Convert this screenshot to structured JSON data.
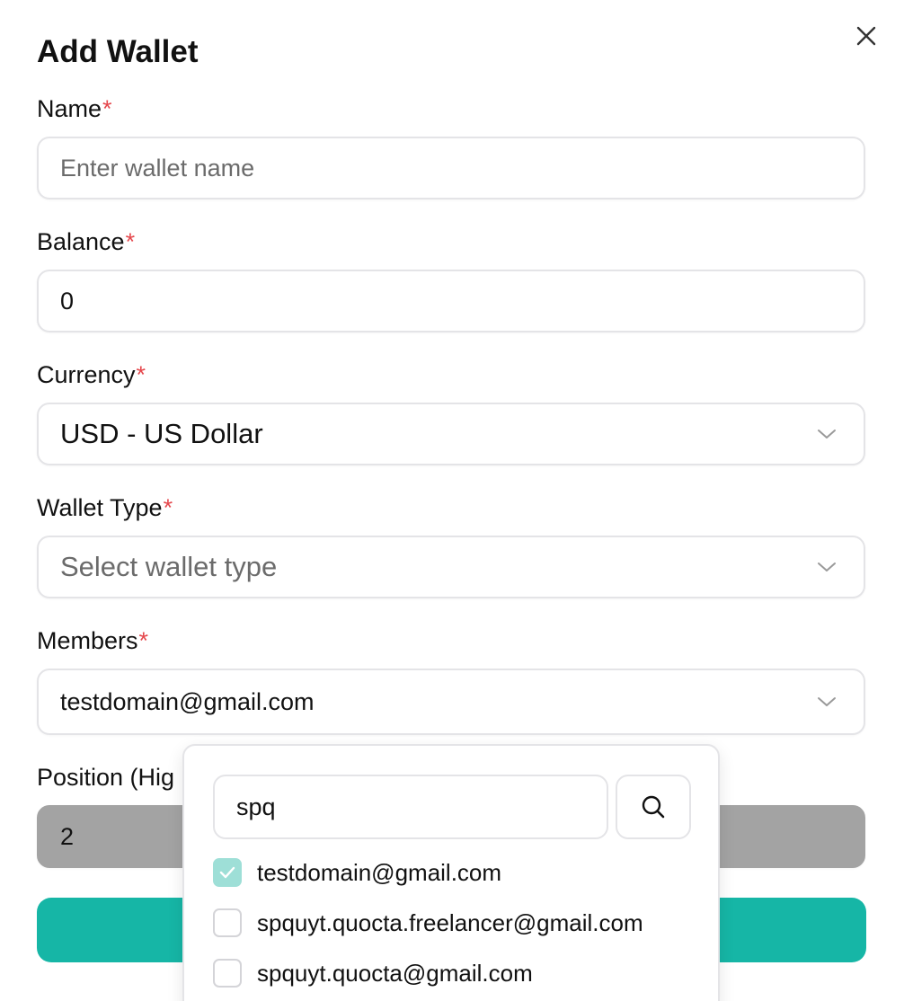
{
  "dialog": {
    "title": "Add Wallet",
    "close_icon": "close-icon"
  },
  "form": {
    "required_mark": "*",
    "name": {
      "label": "Name",
      "placeholder": "Enter wallet name",
      "value": ""
    },
    "balance": {
      "label": "Balance",
      "value": "0"
    },
    "currency": {
      "label": "Currency",
      "value": "USD - US Dollar"
    },
    "wallet_type": {
      "label": "Wallet Type",
      "placeholder": "Select wallet type"
    },
    "members": {
      "label": "Members",
      "value": "testdomain@gmail.com"
    },
    "position": {
      "label": "Position (Hig",
      "value": "2"
    },
    "submit": {
      "label": "",
      "color": "#16b6a6"
    }
  },
  "members_dropdown": {
    "search_value": "spq",
    "search_icon": "search-icon",
    "options": [
      {
        "label": "testdomain@gmail.com",
        "checked": true
      },
      {
        "label": "spquyt.quocta.freelancer@gmail.com",
        "checked": false
      },
      {
        "label": "spquyt.quocta@gmail.com",
        "checked": false
      }
    ]
  },
  "colors": {
    "required": "#e5484d",
    "accent": "#16b6a6",
    "checked_checkbox": "#9edfd7",
    "disabled_field": "#a3a3a3"
  }
}
